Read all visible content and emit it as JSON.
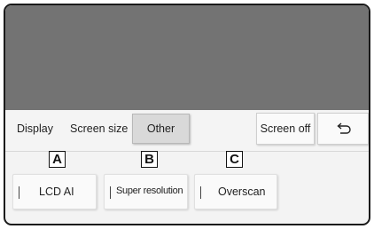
{
  "toolbar": {
    "display_label": "Display",
    "screen_size_label": "Screen size",
    "other_label": "Other",
    "screen_off_label": "Screen off",
    "back_icon": "return-arrow-icon"
  },
  "callouts": [
    "A",
    "B",
    "C"
  ],
  "options": [
    {
      "label": "LCD AI"
    },
    {
      "label": "Super resolution"
    },
    {
      "label": "Overscan"
    }
  ],
  "colors": {
    "screen": "#737373",
    "selected_tab": "#d9d9d9",
    "panel": "#f3f3f3"
  }
}
